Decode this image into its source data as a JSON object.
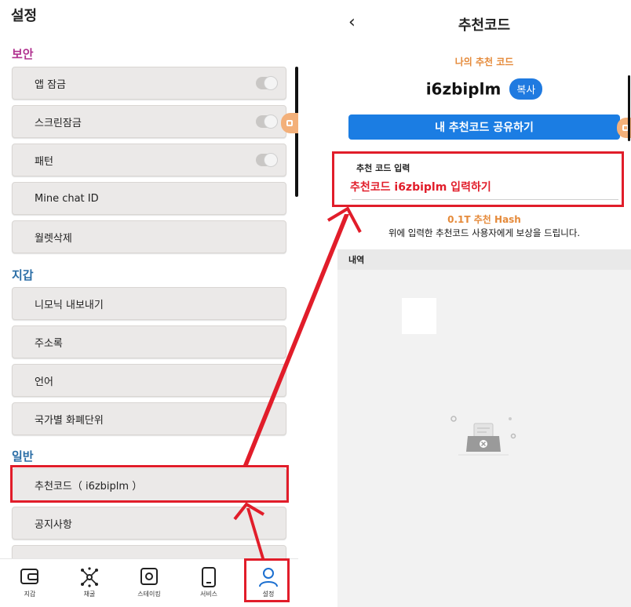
{
  "settings": {
    "title": "설정",
    "sections": {
      "security": "보안",
      "wallet": "지갑",
      "general": "일반"
    },
    "items": {
      "app_lock": "앱 잠금",
      "screen_lock": "스크린잠금",
      "pattern": "패턴",
      "mine_chat_id": "Mine chat ID",
      "wallet_delete": "월렛삭제",
      "mnemonic_export": "니모닉 내보내기",
      "address_book": "주소록",
      "language": "언어",
      "currency": "국가별 화폐단위",
      "referral": "추천코드（ i6zbiplm ）",
      "notice": "공지사항"
    },
    "toggles": {
      "app_lock": false,
      "screen_lock": false,
      "pattern": false
    },
    "colors": {
      "section_security": "#b0328f",
      "section_other": "#2b6ea6",
      "highlight": "#e11d2a"
    }
  },
  "bottom_nav": {
    "wallet": "지갑",
    "mining": "채굴",
    "staking": "스테이킹",
    "service": "서비스",
    "settings": "설정"
  },
  "referral": {
    "title": "추천코드",
    "my_code_label": "나의 추천 코드",
    "code": "i6zbiplm",
    "copy": "복사",
    "share": "내 추천코드 공유하기",
    "input_label": "추천 코드 입력",
    "input_value": "추천코드 i6zbiplm 입력하기",
    "reward": "0.1T 추천 Hash",
    "description": "위에 입력한 추천코드 사용자에게 보상을 드립니다.",
    "history": "내역"
  },
  "icons": [
    "back-chevron-icon",
    "wallet-icon",
    "mining-icon",
    "staking-icon",
    "service-icon",
    "settings-user-icon",
    "empty-inbox-icon",
    "floating-action-icon"
  ]
}
